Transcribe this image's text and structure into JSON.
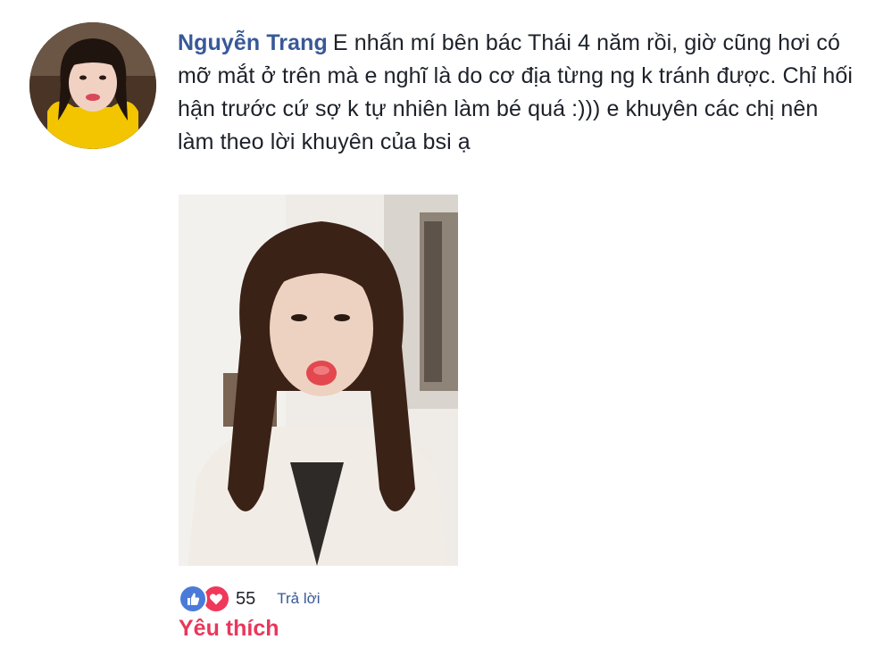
{
  "comment": {
    "author": "Nguyễn Trang",
    "text": "E nhấn mí bên bác Thái 4 năm rồi, giờ cũng hơi có mỡ mắt ở trên mà e nghĩ là do cơ địa từng ng k tránh được. Chỉ hối hận trước cứ sợ k tự nhiên làm bé quá :))) e khuyên các chị nên làm theo lời khuyên của bsi ạ",
    "reactions": {
      "icons": [
        "like-icon",
        "love-icon"
      ],
      "count": "55",
      "like_color": "#4a7bd8",
      "love_color": "#f0385a"
    },
    "reply_label": "Trả lời",
    "liked_label": "Yêu thích"
  },
  "colors": {
    "author": "#385898",
    "text": "#1d2129",
    "liked": "#e7385b"
  }
}
